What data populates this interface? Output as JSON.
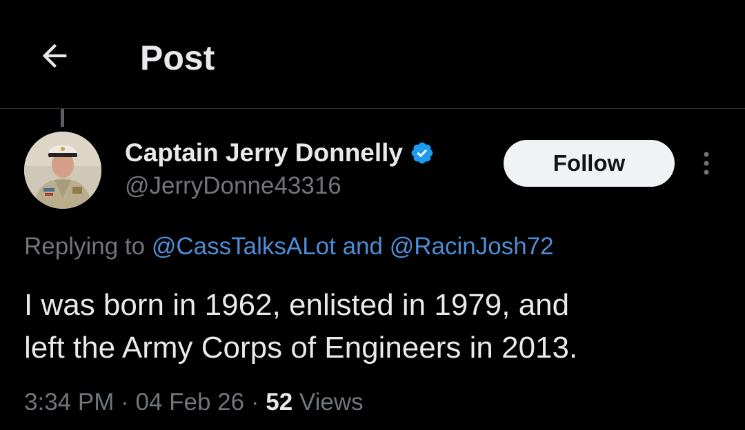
{
  "header": {
    "title": "Post",
    "back_icon": "arrow-left-icon"
  },
  "post": {
    "author": {
      "display_name": "Captain Jerry Donnelly",
      "handle": "@JerryDonne43316",
      "verified": true,
      "verified_color": "#1d9bf0"
    },
    "follow_label": "Follow",
    "replying": {
      "prefix": "Replying to",
      "mention1": "@CassTalksALot",
      "conjunction": "and",
      "mention2": "@RacinJosh72"
    },
    "text_line1": "I was born in 1962, enlisted in 1979, and",
    "text_line2": "left the Army Corps of Engineers in 2013.",
    "meta": {
      "time": "3:34 PM",
      "separator": "·",
      "date": "04 Feb 26",
      "views_count": "52",
      "views_label": "Views"
    }
  },
  "colors": {
    "background": "#000000",
    "text": "#e7e9ea",
    "muted": "#71767b",
    "link": "#4d8ed8",
    "follow_bg": "#eff3f4"
  }
}
